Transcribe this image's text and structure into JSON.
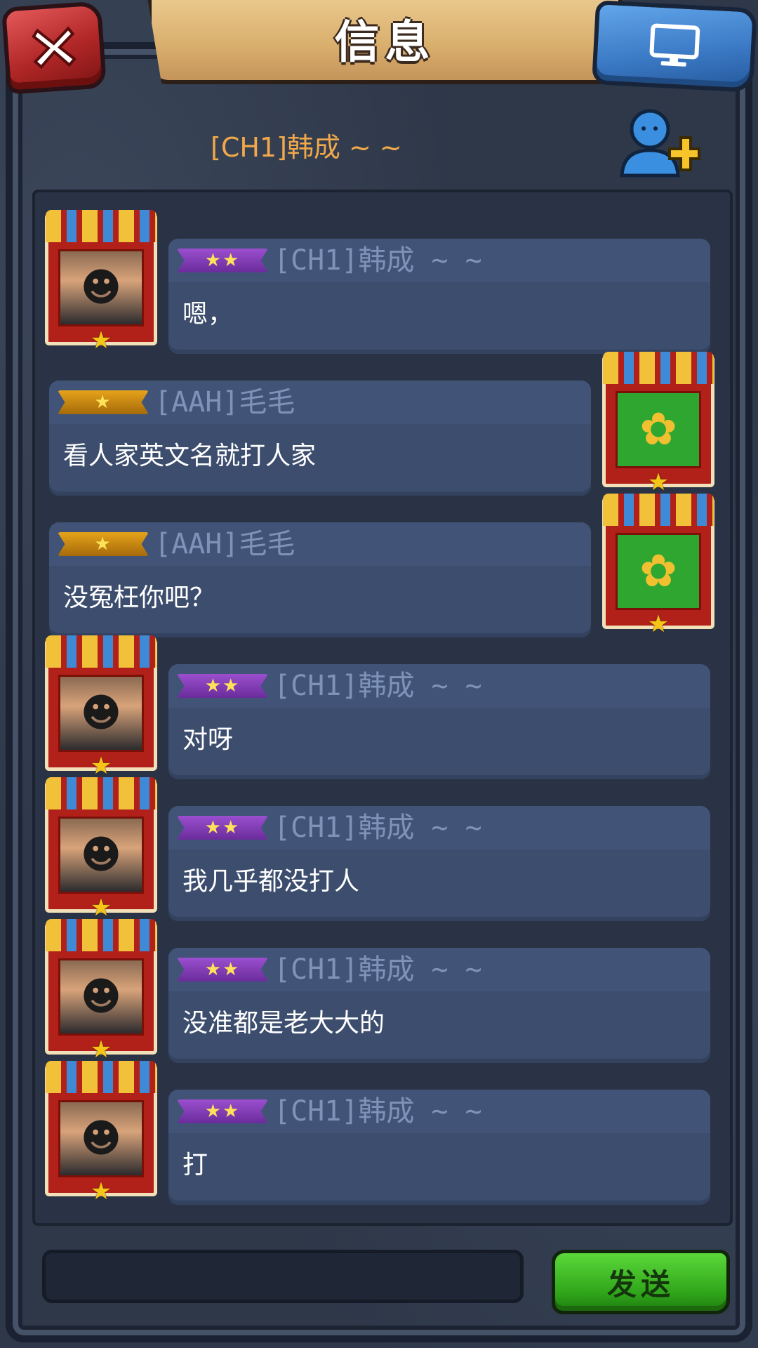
{
  "header": {
    "title": "信息",
    "chat_target": "[CH1]韩成 ~ ~"
  },
  "messages": [
    {
      "side": "left",
      "avatar": "hero-portrait",
      "rank_stars": "★★",
      "rank_color": "#7a3bb5",
      "name": "[CH1]韩成 ~ ~",
      "text": "嗯，"
    },
    {
      "side": "right",
      "avatar": "sunflower-portrait",
      "rank_stars": "★",
      "rank_color": "#c68a12",
      "name": "[AAH]毛毛",
      "text": "看人家英文名就打人家"
    },
    {
      "side": "right",
      "avatar": "sunflower-portrait",
      "rank_stars": "★",
      "rank_color": "#c68a12",
      "name": "[AAH]毛毛",
      "text": "没冤枉你吧？"
    },
    {
      "side": "left",
      "avatar": "hero-portrait",
      "rank_stars": "★★",
      "rank_color": "#7a3bb5",
      "name": "[CH1]韩成 ~ ~",
      "text": "对呀"
    },
    {
      "side": "left",
      "avatar": "hero-portrait",
      "rank_stars": "★★",
      "rank_color": "#7a3bb5",
      "name": "[CH1]韩成 ~ ~",
      "text": "我几乎都没打人"
    },
    {
      "side": "left",
      "avatar": "hero-portrait",
      "rank_stars": "★★",
      "rank_color": "#7a3bb5",
      "name": "[CH1]韩成 ~ ~",
      "text": "没准都是老大大的"
    },
    {
      "side": "left",
      "avatar": "hero-portrait",
      "rank_stars": "★★",
      "rank_color": "#7a3bb5",
      "name": "[CH1]韩成 ~ ~",
      "text": "打"
    }
  ],
  "composer": {
    "input_value": "",
    "send_label": "发送"
  },
  "icons": {
    "close": "close-icon",
    "monitor": "monitor-icon",
    "add_friend": "add-friend-icon"
  }
}
